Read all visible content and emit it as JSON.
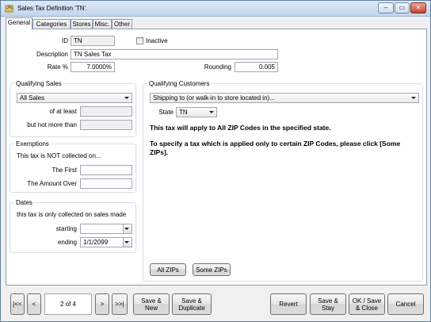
{
  "window": {
    "title": "Sales Tax Definition 'TN'.",
    "minimize_label": "–",
    "restore_label": "▭",
    "close_label": "✕"
  },
  "tabs": [
    {
      "label": "General"
    },
    {
      "label": "Categories"
    },
    {
      "label": "Stores"
    },
    {
      "label": "Misc."
    },
    {
      "label": "Other"
    }
  ],
  "general": {
    "id_label": "ID",
    "id_value": "TN",
    "inactive_label": "Inactive",
    "inactive_checked": false,
    "description_label": "Description",
    "description_value": "TN Sales Tax",
    "rate_label": "Rate %",
    "rate_value": "7.0000%",
    "rounding_label": "Rounding",
    "rounding_value": "0.005"
  },
  "qualifying_sales": {
    "title": "Qualifying Sales",
    "selected": "All Sales",
    "at_least_label": "of at least",
    "at_least_value": "",
    "not_more_label": "but not more than",
    "not_more_value": ""
  },
  "exemptions": {
    "title": "Exemptions",
    "intro": "This tax is NOT collected on...",
    "first_label": "The First",
    "first_value": "",
    "over_label": "The Amount Over",
    "over_value": ""
  },
  "dates": {
    "title": "Dates",
    "intro": "this tax is only collected on sales made",
    "starting_label": "starting",
    "starting_value": "",
    "ending_label": "ending",
    "ending_value": "1/1/2099"
  },
  "qualifying_customers": {
    "title": "Qualifying Customers",
    "selected": "Shipping to (or walk-in to store located in)...",
    "state_label": "State",
    "state_value": "TN",
    "message1": "This tax will apply to All ZIP Codes in the specified state.",
    "message2": "To specify a tax which is applied only to certain ZIP Codes, please click [Some ZIPs].",
    "all_zips_label": "All ZIPs",
    "some_zips_label": "Some ZIPs"
  },
  "footer": {
    "first_label": "|<<",
    "prev_label": "<",
    "record_position": "2 of 4",
    "next_label": ">",
    "last_label": ">>|",
    "save_new_label": "Save & New",
    "save_duplicate_label": "Save & Duplicate",
    "revert_label": "Revert",
    "save_stay_label": "Save & Stay",
    "ok_save_close_label": "OK / Save & Close",
    "cancel_label": "Cancel"
  }
}
